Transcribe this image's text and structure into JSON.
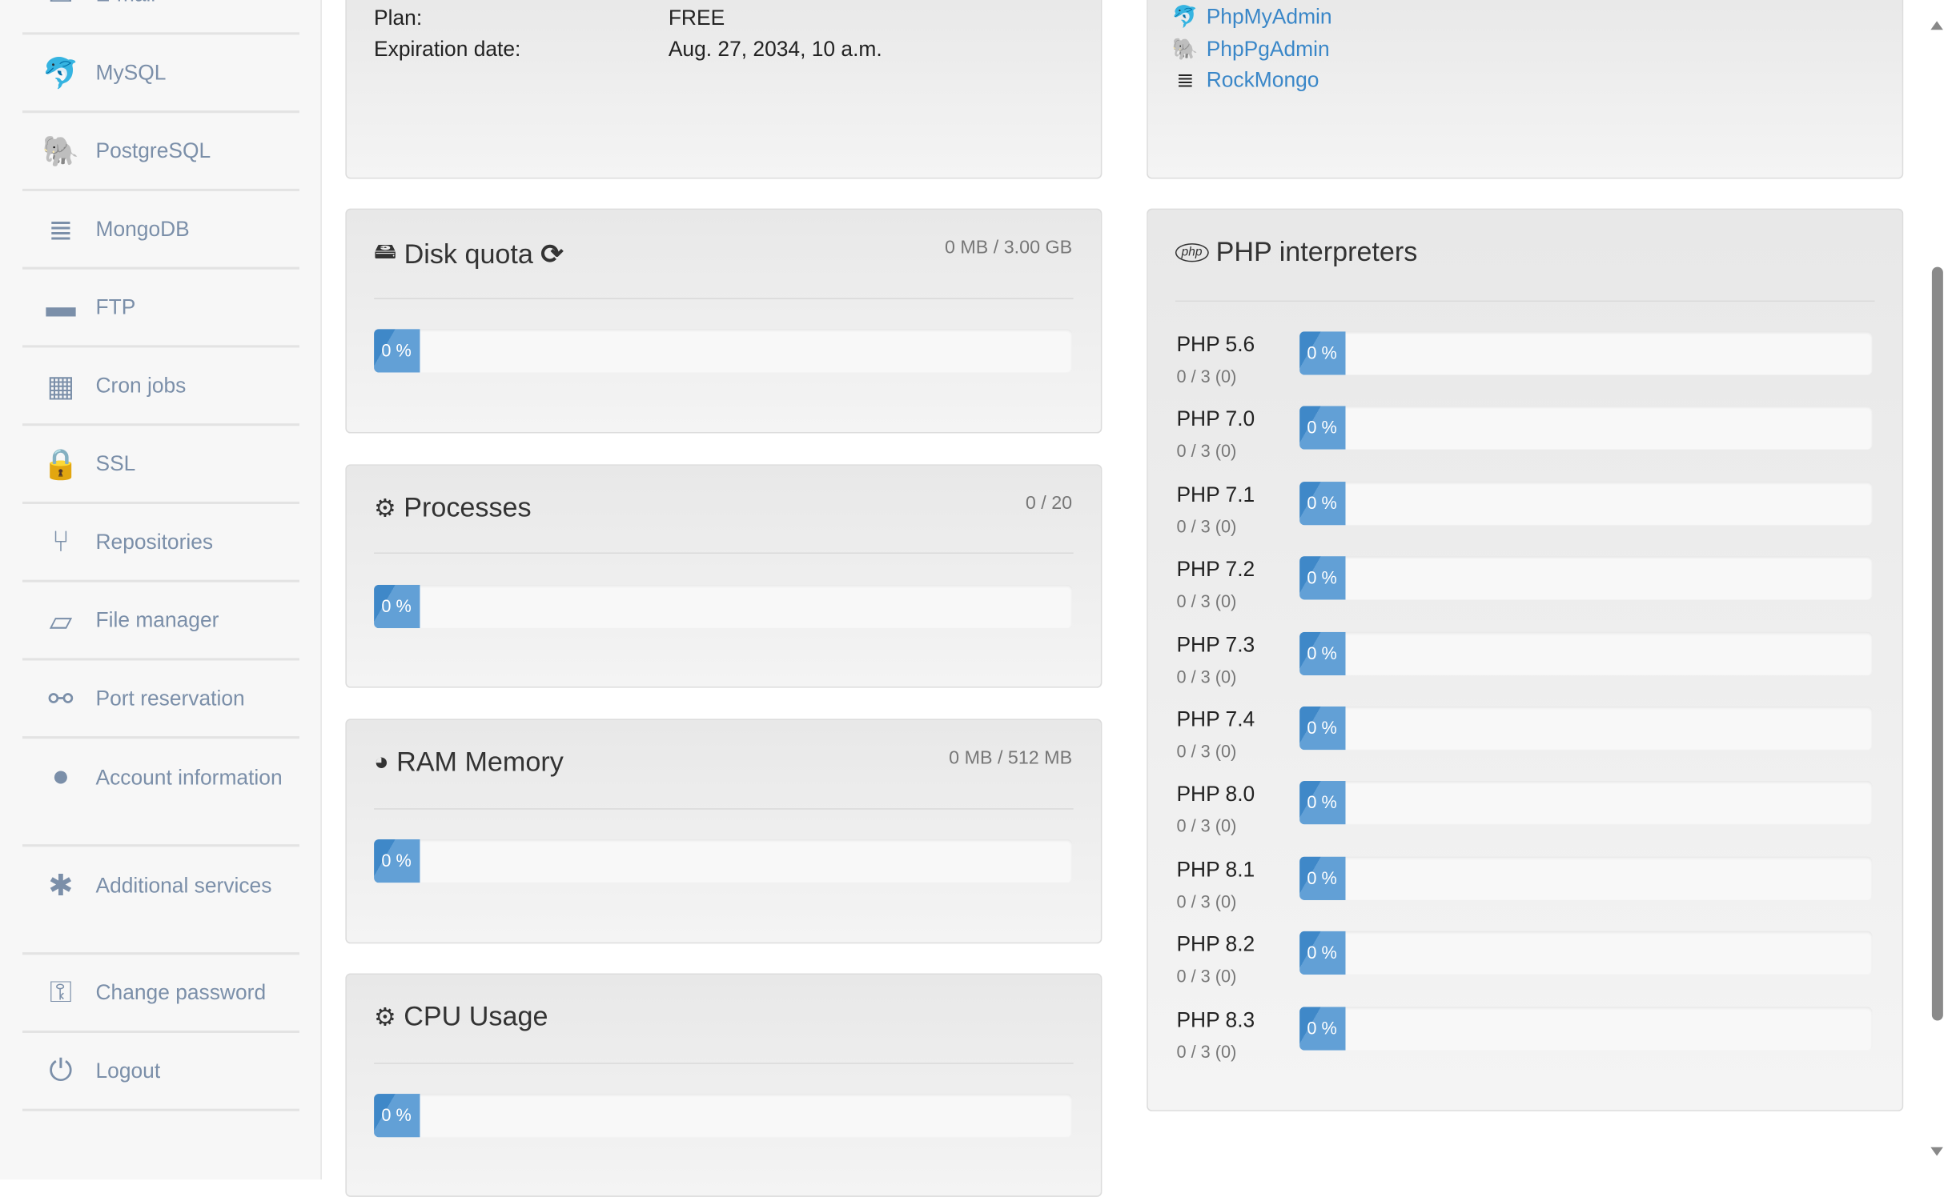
{
  "sidebar": {
    "items": [
      {
        "label": "E-mail",
        "icon": "envelope-icon"
      },
      {
        "label": "MySQL",
        "icon": "dolphin-icon"
      },
      {
        "label": "PostgreSQL",
        "icon": "elephant-icon"
      },
      {
        "label": "MongoDB",
        "icon": "database-icon"
      },
      {
        "label": "FTP",
        "icon": "folder-icon"
      },
      {
        "label": "Cron jobs",
        "icon": "calendar-icon"
      },
      {
        "label": "SSL",
        "icon": "lock-icon"
      },
      {
        "label": "Repositories",
        "icon": "branch-icon"
      },
      {
        "label": "File manager",
        "icon": "folder-open-icon"
      },
      {
        "label": "Port reservation",
        "icon": "unlink-icon"
      },
      {
        "label": "Account information",
        "icon": "user-icon"
      },
      {
        "label": "Additional services",
        "icon": "asterisk-icon"
      },
      {
        "label": "Change password",
        "icon": "key-icon"
      },
      {
        "label": "Logout",
        "icon": "power-icon"
      }
    ]
  },
  "account": {
    "plan_label": "Plan:",
    "plan_value": "FREE",
    "expiration_label": "Expiration date:",
    "expiration_value": "Aug. 27, 2034, 10 a.m."
  },
  "tools": {
    "links": [
      {
        "label": "PhpMyAdmin",
        "icon": "dolphin-icon"
      },
      {
        "label": "PhpPgAdmin",
        "icon": "elephant-icon"
      },
      {
        "label": "RockMongo",
        "icon": "database-icon"
      }
    ]
  },
  "disk": {
    "title": "Disk quota",
    "usage": "0 MB / 3.00 GB",
    "percent": 0,
    "percent_label": "0 %"
  },
  "processes": {
    "title": "Processes",
    "usage": "0 / 20",
    "percent": 0,
    "percent_label": "0 %"
  },
  "ram": {
    "title": "RAM Memory",
    "usage": "0 MB / 512 MB",
    "percent": 0,
    "percent_label": "0 %"
  },
  "cpu": {
    "title": "CPU Usage",
    "percent": 0,
    "percent_label": "0 %"
  },
  "php": {
    "title": "PHP interpreters",
    "rows": [
      {
        "version": "PHP 5.6",
        "count": "0 / 3 (0)",
        "percent": 0,
        "percent_label": "0 %"
      },
      {
        "version": "PHP 7.0",
        "count": "0 / 3 (0)",
        "percent": 0,
        "percent_label": "0 %"
      },
      {
        "version": "PHP 7.1",
        "count": "0 / 3 (0)",
        "percent": 0,
        "percent_label": "0 %"
      },
      {
        "version": "PHP 7.2",
        "count": "0 / 3 (0)",
        "percent": 0,
        "percent_label": "0 %"
      },
      {
        "version": "PHP 7.3",
        "count": "0 / 3 (0)",
        "percent": 0,
        "percent_label": "0 %"
      },
      {
        "version": "PHP 7.4",
        "count": "0 / 3 (0)",
        "percent": 0,
        "percent_label": "0 %"
      },
      {
        "version": "PHP 8.0",
        "count": "0 / 3 (0)",
        "percent": 0,
        "percent_label": "0 %"
      },
      {
        "version": "PHP 8.1",
        "count": "0 / 3 (0)",
        "percent": 0,
        "percent_label": "0 %"
      },
      {
        "version": "PHP 8.2",
        "count": "0 / 3 (0)",
        "percent": 0,
        "percent_label": "0 %"
      },
      {
        "version": "PHP 8.3",
        "count": "0 / 3 (0)",
        "percent": 0,
        "percent_label": "0 %"
      }
    ]
  },
  "colors": {
    "accent": "#3f88c8",
    "link": "#3a87c8",
    "sidebar_text": "#7b8fa9"
  }
}
